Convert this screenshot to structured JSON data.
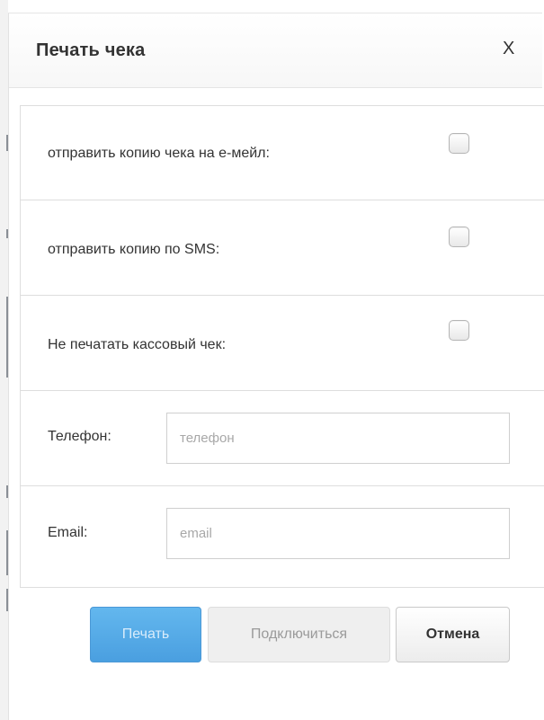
{
  "dialog": {
    "title": "Печать чека",
    "close_label": "X"
  },
  "options": [
    {
      "label": "отправить копию чека на е-мейл:",
      "checked": false
    },
    {
      "label": "отправить копию по SMS:",
      "checked": false
    },
    {
      "label": "Не печатать кассовый чек:",
      "checked": false
    }
  ],
  "fields": {
    "phone": {
      "label": "Телефон:",
      "placeholder": "телефон",
      "value": ""
    },
    "email": {
      "label": "Email:",
      "placeholder": "email",
      "value": ""
    }
  },
  "buttons": {
    "print_label": "Печать",
    "connect_label": "Подключиться",
    "cancel_label": "Отмена"
  },
  "colors": {
    "primary_button": "#5aaee8",
    "border": "#dedede",
    "text": "#333333"
  }
}
